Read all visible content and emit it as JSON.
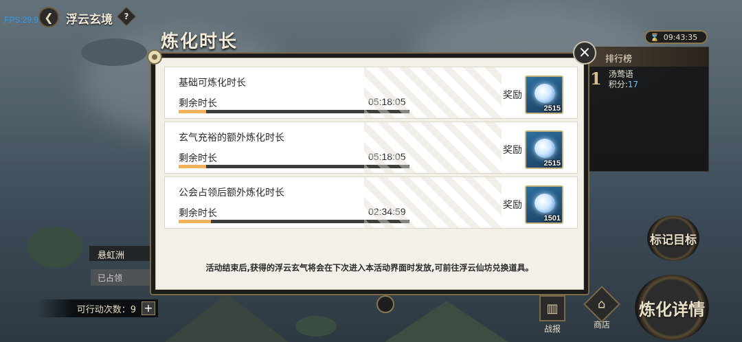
{
  "hud": {
    "fps": "FPS:29.91",
    "scene_title": "浮云玄境",
    "help": "?",
    "timer": "09:43:35"
  },
  "ranking": {
    "title": "排行榜",
    "rank": "1",
    "name": "汤莺语",
    "score_label": "积分:",
    "score": "17"
  },
  "map": {
    "region_name": "悬虹洲",
    "occupied": "已占领",
    "actions_label": "可行动次数：9",
    "plus": "+"
  },
  "buttons": {
    "mark_target": "标记目标",
    "refine_details": "炼化详情",
    "battle_report": "战报",
    "shop": "商店"
  },
  "modal": {
    "title": "炼化时长",
    "close": "×",
    "reward_label": "奖励",
    "remain_label": "剩余时长",
    "cards": [
      {
        "title": "基础可炼化时长",
        "time": "05:18:05",
        "progress": 0.12,
        "reward": "2515"
      },
      {
        "title": "玄气充裕的额外炼化时长",
        "time": "05:18:05",
        "progress": 0.12,
        "reward": "2515"
      },
      {
        "title": "公会占领后额外炼化时长",
        "time": "02:34:59",
        "progress": 0.14,
        "reward": "1501"
      }
    ],
    "footnote": "活动结束后,获得的浮云玄气将会在下次进入本活动界面时发放,可前往浮云仙坊兑换道具。"
  },
  "colors": {
    "progress_fill": "#f2b25a",
    "score_value": "#6cc6ff",
    "fps_text": "#2a9df4"
  }
}
